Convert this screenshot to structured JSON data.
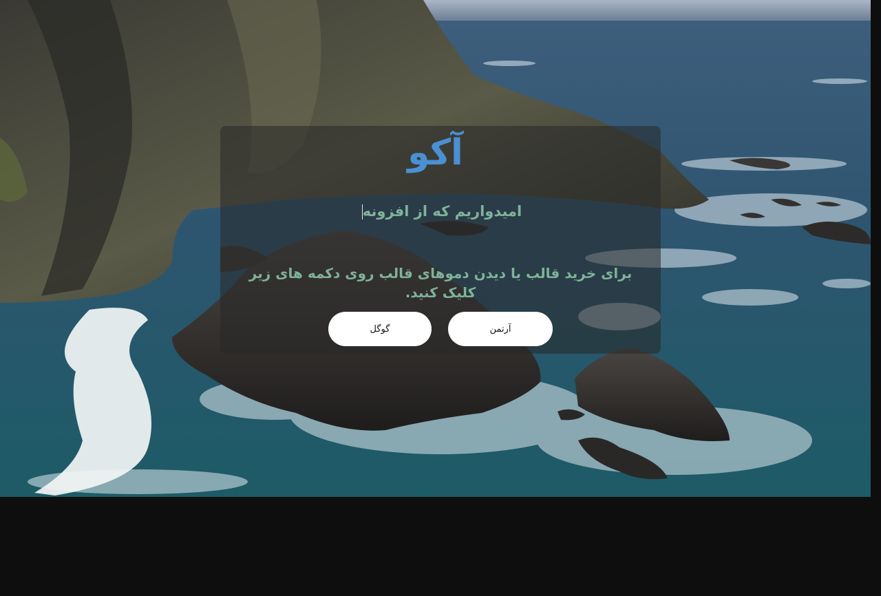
{
  "hero": {
    "brand": "آکو",
    "typed_text": "امیدواریم که از افزونه",
    "description": "برای خرید قالب یا دیدن دموهای قالب روی دکمه های زیر کلیک کنید.",
    "buttons": {
      "artemn_label": "آرتمن",
      "google_label": "گوگل"
    }
  },
  "colors": {
    "brand": "#4a90d4",
    "text_accent": "#7fb29a",
    "button_bg": "#ffffff",
    "page_bg": "#0e0e0e"
  }
}
